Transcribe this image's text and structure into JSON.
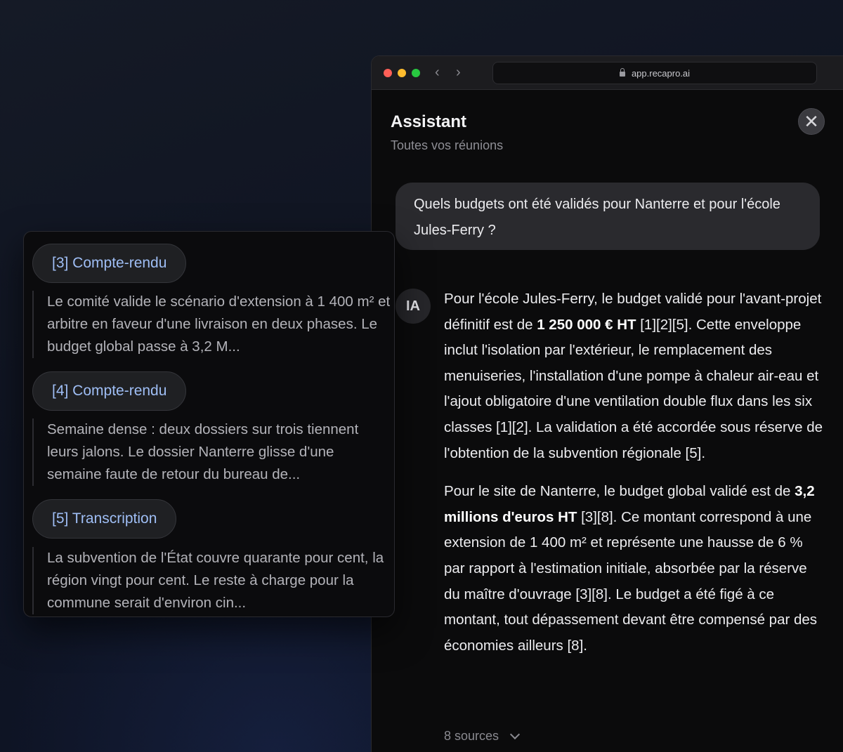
{
  "browser": {
    "url": "app.recapro.ai"
  },
  "header": {
    "title": "Assistant",
    "subtitle": "Toutes vos réunions",
    "close_label": "✕"
  },
  "question": {
    "text": "Quels budgets ont été validés pour Nanterre et pour l'école Jules-Ferry ?"
  },
  "answer": {
    "avatar": "IA",
    "p1_a": "Pour l'école Jules-Ferry, le budget validé pour l'avant-projet définitif est de ",
    "p1_bold": "1 250 000 € HT",
    "p1_b": " [1][2][5]. Cette enveloppe inclut l'isolation par l'extérieur, le remplacement des menuiseries, l'installation d'une pompe à chaleur air-eau et l'ajout obligatoire d'une ventilation double flux dans les six classes [1][2]. La validation a été accordée sous réserve de l'obtention de la subvention régionale [5].",
    "p2_a": "Pour le site de Nanterre, le budget global validé est de ",
    "p2_bold": "3,2 millions d'euros HT",
    "p2_b": " [3][8]. Ce montant correspond à une extension de 1 400 m² et représente une hausse de 6 % par rapport à l'estimation initiale, absorbée par la réserve du maître d'ouvrage [3][8]. Le budget a été figé à ce montant, tout dépassement devant être compensé par des économies ailleurs [8]."
  },
  "sources_toggle": {
    "label": "8 sources"
  },
  "popover": {
    "sources": [
      {
        "label": "[3] Compte-rendu",
        "snippet": "Le comité valide le scénario d'extension à 1 400 m² et arbitre en faveur d'une livraison en deux phases. Le budget global passe à 3,2 M..."
      },
      {
        "label": "[4] Compte-rendu",
        "snippet": "Semaine dense : deux dossiers sur trois tiennent leurs jalons. Le dossier Nanterre glisse d'une semaine faute de retour du bureau de..."
      },
      {
        "label": "[5] Transcription",
        "snippet": "La subvention de l'État couvre quarante pour cent, la région vingt pour cent. Le reste à charge pour la commune serait d'environ cin..."
      }
    ]
  }
}
